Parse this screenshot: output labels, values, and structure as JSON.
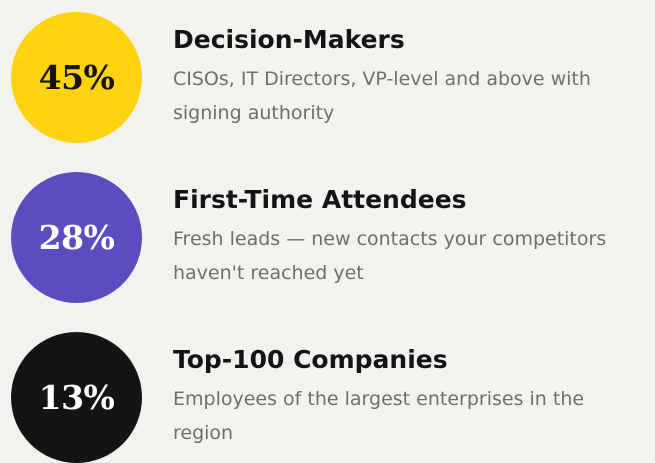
{
  "stats": [
    {
      "value": "45%",
      "title": "Decision-Makers",
      "description": "CISOs, IT Directors, VP-level and above with signing authority",
      "circle_color": "#fcd30c",
      "value_color": "#141414"
    },
    {
      "value": "28%",
      "title": "First-Time Attendees",
      "description": "Fresh leads — new contacts your competitors haven't reached yet",
      "circle_color": "#5b4cc0",
      "value_color": "#ffffff"
    },
    {
      "value": "13%",
      "title": "Top-100 Companies",
      "description": "Employees of the largest enterprises in the region",
      "circle_color": "#141414",
      "value_color": "#ffffff"
    }
  ]
}
